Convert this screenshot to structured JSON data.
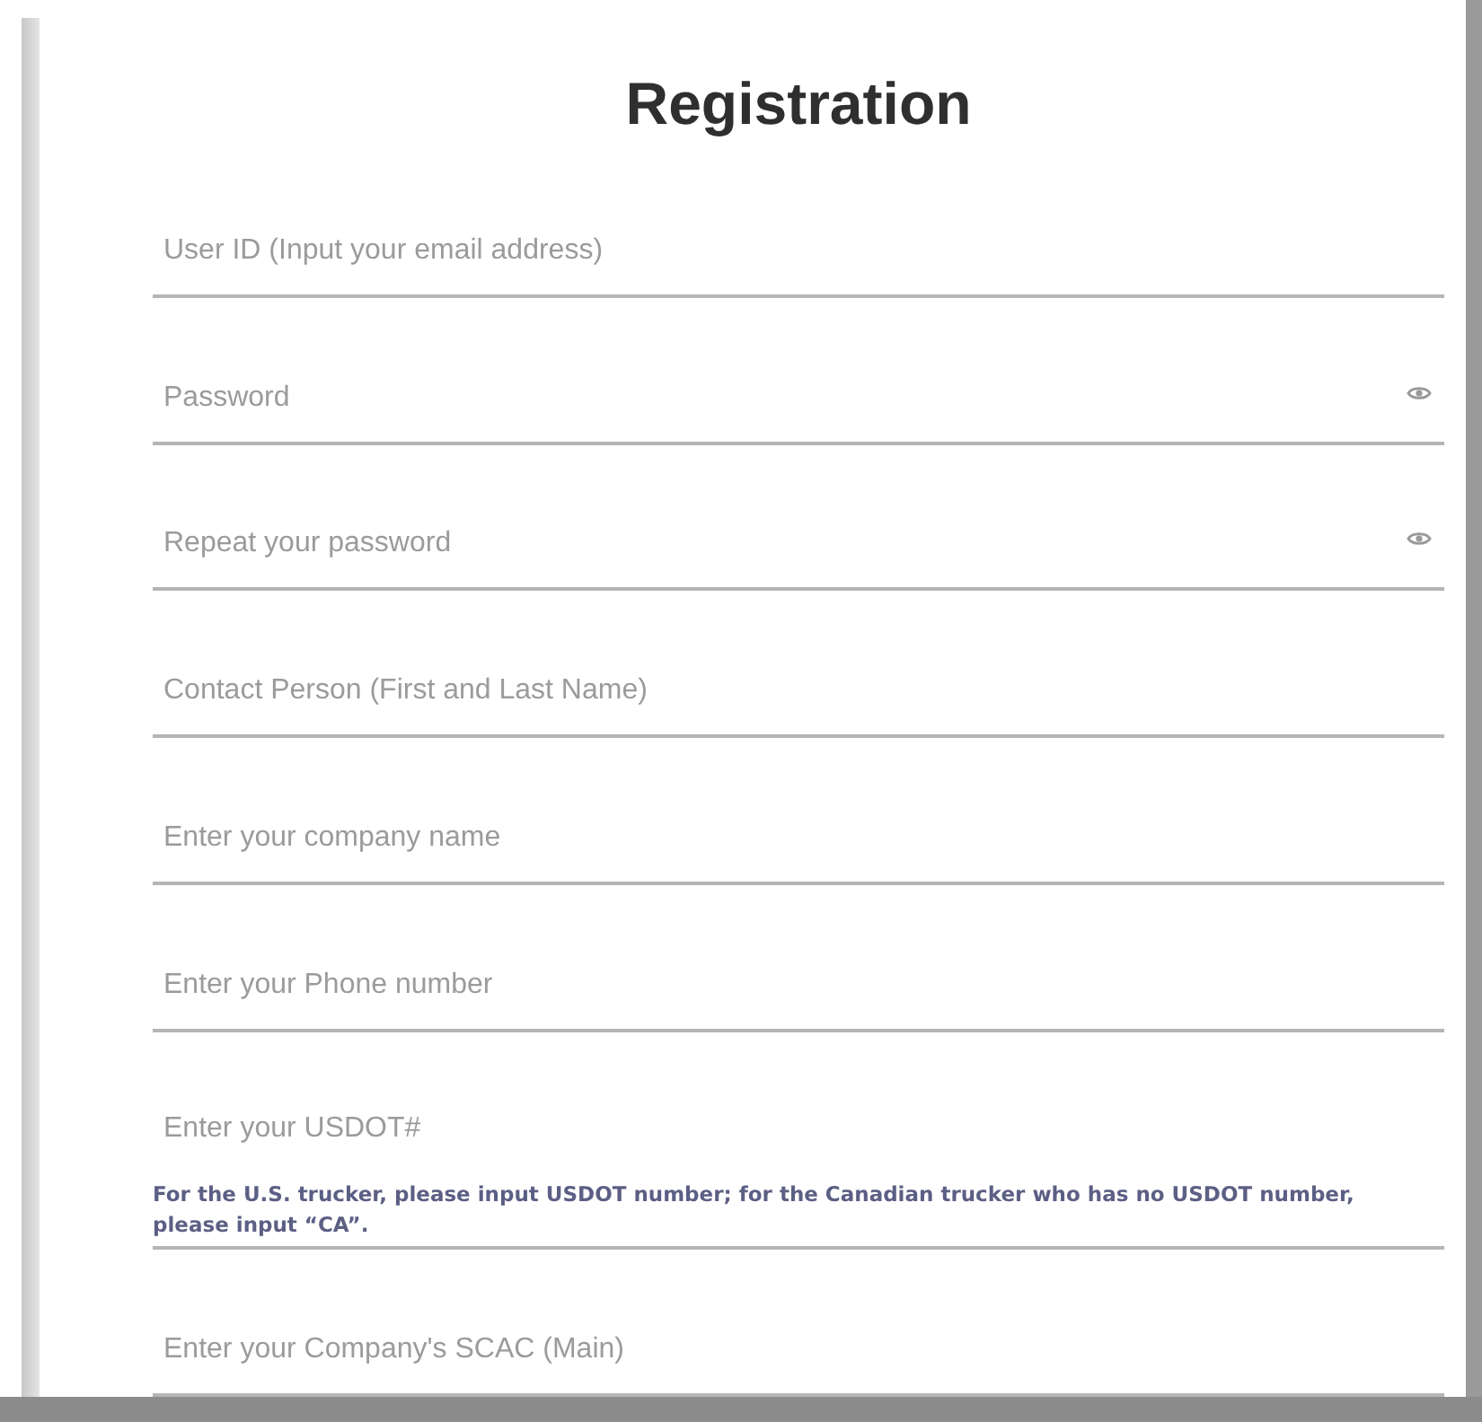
{
  "title": "Registration",
  "fields": [
    {
      "kind": "text",
      "placeholder": "User ID (Input your email address)"
    },
    {
      "kind": "password",
      "placeholder": "Password"
    },
    {
      "kind": "password",
      "placeholder": "Repeat your password"
    },
    {
      "kind": "text",
      "placeholder": "Contact Person (First and Last Name)"
    },
    {
      "kind": "text",
      "placeholder": "Enter your company name"
    },
    {
      "kind": "text",
      "placeholder": "Enter your Phone number"
    },
    {
      "kind": "text",
      "placeholder": "Enter your USDOT#",
      "note": "For the U.S. trucker, please input USDOT number; for the Canadian trucker who has no USDOT number, please input “CA”."
    },
    {
      "kind": "text",
      "placeholder": "Enter your Company's SCAC (Main)"
    }
  ]
}
